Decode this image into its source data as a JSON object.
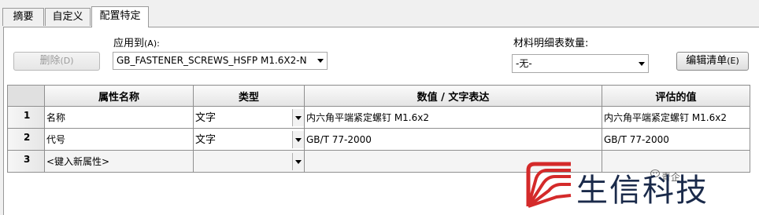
{
  "tabs": [
    {
      "label": "摘要"
    },
    {
      "label": "自定义"
    },
    {
      "label": "配置特定"
    }
  ],
  "apply_to": {
    "label": "应用到",
    "label_suffix": "(A):",
    "value": "GB_FASTENER_SCREWS_HSFP M1.6X2-N"
  },
  "bom_quantity": {
    "label": "材料明细表数量:",
    "value": "-无-"
  },
  "buttons": {
    "delete": "删除",
    "delete_hotkey": "(D)",
    "edit_list": "编辑清单",
    "edit_list_hotkey": "(E)"
  },
  "table": {
    "headers": [
      "属性名称",
      "类型",
      "数值 / 文字表达",
      "评估的值"
    ],
    "rows": [
      {
        "num": "1",
        "name": "名称",
        "type": "文字",
        "value": "内六角平端紧定螺钉 M1.6x2",
        "evaluated": "内六角平端紧定螺钉 M1.6x2"
      },
      {
        "num": "2",
        "name": "代号",
        "type": "文字",
        "value": "GB/T 77-2000",
        "evaluated": "GB/T 77-2000"
      },
      {
        "num": "3",
        "name": "<键入新属性>",
        "type": "",
        "value": "",
        "evaluated": ""
      }
    ]
  },
  "watermark": {
    "brand": "生信科技",
    "wechat_label": "青企"
  },
  "colors": {
    "watermark_red": "#d42a2a",
    "watermark_navy": "#1a2a4a"
  }
}
